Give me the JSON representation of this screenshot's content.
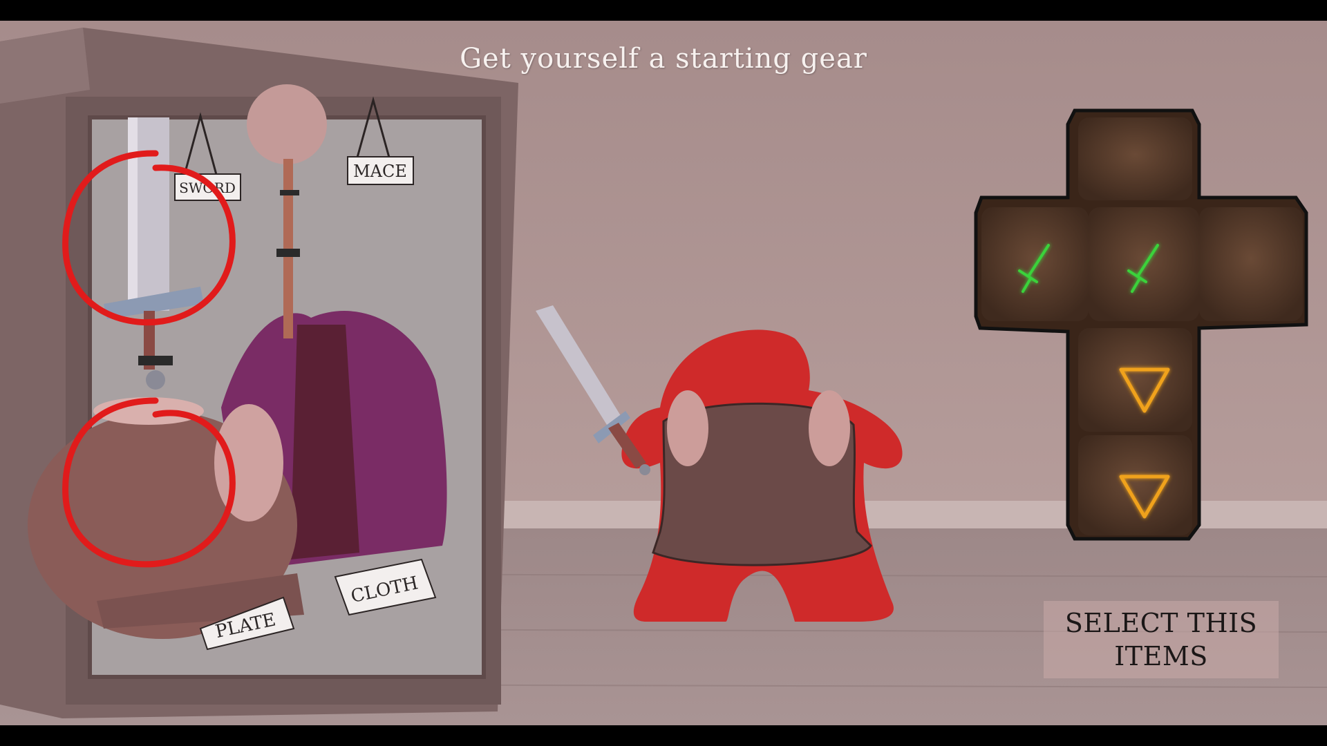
{
  "screen": {
    "title": "Get yourself a starting gear"
  },
  "shop": {
    "labels": {
      "sword": "SWORD",
      "mace": "MACE",
      "plate": "PLATE",
      "cloth": "CLOTH"
    },
    "highlight_color": "#e11b1b"
  },
  "player": {
    "meeple_color": "#cf2a2a"
  },
  "dice": {
    "faces": [
      {
        "slot": "top",
        "icon": "empty-face"
      },
      {
        "slot": "left",
        "icon": "sword-icon",
        "glow": "#3bd23b"
      },
      {
        "slot": "center",
        "icon": "sword-icon",
        "glow": "#3bd23b"
      },
      {
        "slot": "right",
        "icon": "empty-face"
      },
      {
        "slot": "lower",
        "icon": "triangle-icon",
        "glow": "#f0a21a"
      },
      {
        "slot": "bottom",
        "icon": "triangle-icon",
        "glow": "#f0a21a"
      }
    ]
  },
  "actions": {
    "select_label": "SELECT THIS ITEMS"
  }
}
